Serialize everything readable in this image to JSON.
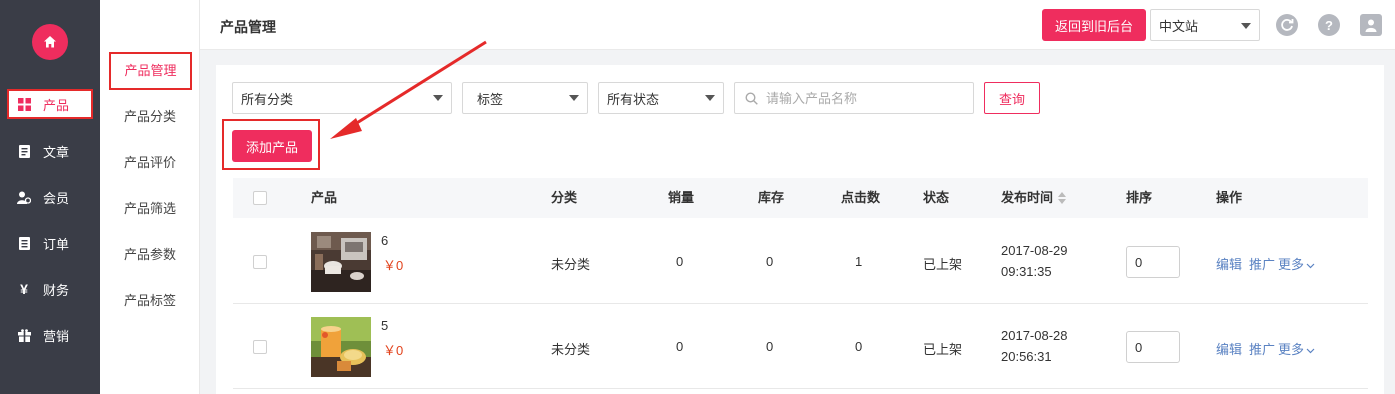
{
  "colors": {
    "accent": "#ef2d5e",
    "sidebar_bg": "#3a3d47",
    "link": "#5a82c2",
    "price": "#e2431d",
    "annotation": "#e52a2a"
  },
  "sidebar": {
    "home_icon": "home-icon",
    "items": [
      {
        "label": "产品",
        "icon": "grid-icon",
        "active": true
      },
      {
        "label": "文章",
        "icon": "document-icon"
      },
      {
        "label": "会员",
        "icon": "members-icon"
      },
      {
        "label": "订单",
        "icon": "order-icon"
      },
      {
        "label": "财务",
        "icon": "yen-icon"
      },
      {
        "label": "营销",
        "icon": "gift-icon"
      }
    ]
  },
  "subnav": {
    "items": [
      {
        "label": "产品管理",
        "active": true
      },
      {
        "label": "产品分类"
      },
      {
        "label": "产品评价"
      },
      {
        "label": "产品筛选"
      },
      {
        "label": "产品参数"
      },
      {
        "label": "产品标签"
      }
    ]
  },
  "header": {
    "title": "产品管理",
    "back_button": "返回到旧后台",
    "site_select": "中文站",
    "icons": [
      "refresh-icon",
      "help-icon",
      "user-icon"
    ]
  },
  "filters": {
    "category": "所有分类",
    "tag": "标签",
    "status": "所有状态",
    "search_placeholder": "请输入产品名称",
    "query_button": "查询",
    "add_button": "添加产品"
  },
  "table": {
    "headers": {
      "product": "产品",
      "category": "分类",
      "sales": "销量",
      "stock": "库存",
      "clicks": "点击数",
      "status": "状态",
      "publish_time": "发布时间",
      "sort": "排序",
      "actions": "操作"
    },
    "rows": [
      {
        "name": "6",
        "price": "￥0",
        "image": "coffee-shop-photo",
        "category": "未分类",
        "sales": "0",
        "stock": "0",
        "clicks": "1",
        "status": "已上架",
        "date": "2017-08-29",
        "time": "09:31:35",
        "sort": "0",
        "edit": "编辑",
        "promote": "推广",
        "more": "更多"
      },
      {
        "name": "5",
        "price": "￥0",
        "image": "drink-cake-photo",
        "category": "未分类",
        "sales": "0",
        "stock": "0",
        "clicks": "0",
        "status": "已上架",
        "date": "2017-08-28",
        "time": "20:56:31",
        "sort": "0",
        "edit": "编辑",
        "promote": "推广",
        "more": "更多"
      }
    ]
  }
}
